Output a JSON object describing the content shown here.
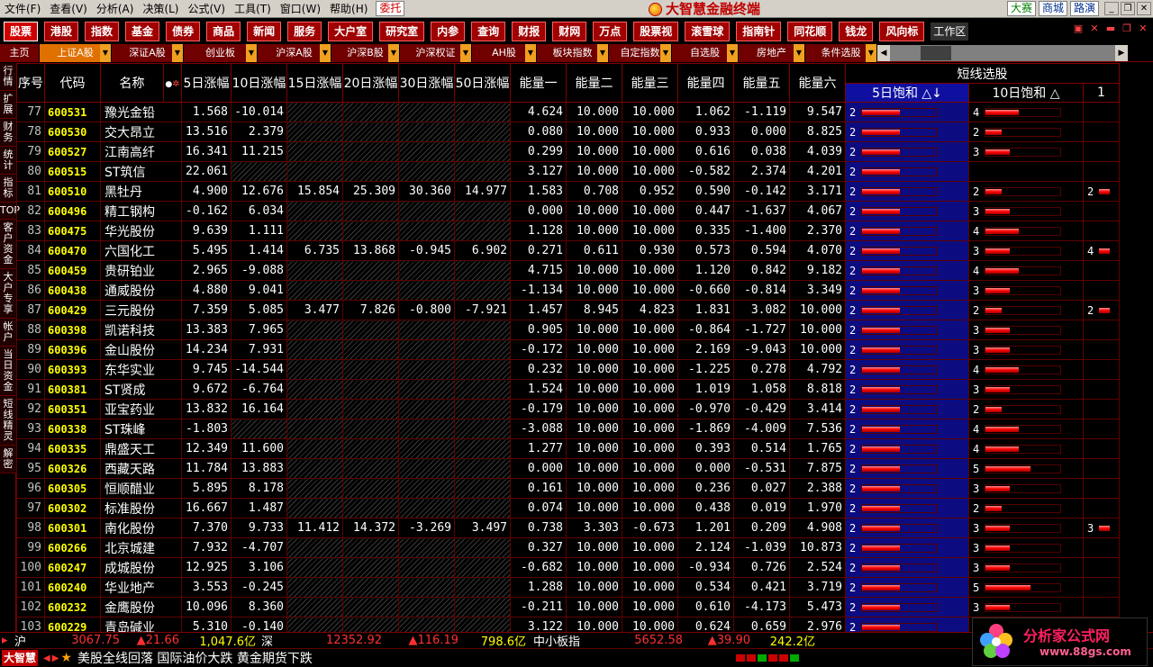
{
  "menubar": {
    "items": [
      "文件(F)",
      "查看(V)",
      "分析(A)",
      "决策(L)",
      "公式(V)",
      "工具(T)",
      "窗口(W)",
      "帮助(H)"
    ],
    "entrust": "委托",
    "title": "大智慧金融终端",
    "right_links": [
      "大赛",
      "商城",
      "路演"
    ]
  },
  "toolbar": {
    "buttons": [
      "股票",
      "港股",
      "指数",
      "基金",
      "债券",
      "商品",
      "新闻",
      "服务",
      "大户室",
      "研究室",
      "内参",
      "查询",
      "财报",
      "财网",
      "万点",
      "股票视",
      "滚雪球",
      "指南针",
      "同花顺",
      "钱龙",
      "风向标"
    ],
    "active": 0,
    "workspace": "工作区"
  },
  "tabs": {
    "items": [
      "主页",
      "上证A股",
      "深证A股",
      "创业板",
      "沪深A股",
      "沪深B股",
      "沪深权证",
      "AH股",
      "板块指数",
      "自定指数",
      "自选股",
      "房地产",
      "条件选股"
    ],
    "active": 1
  },
  "leftbar": [
    "行情",
    "扩展",
    "财务",
    "统计",
    "指标",
    "TOP",
    "客户资金",
    "大户专享",
    "帐户",
    "当日资金",
    "短线精灵",
    "解密"
  ],
  "grid": {
    "group_header": "短线选股",
    "headers": [
      "序号",
      "代码",
      "名称",
      "5日涨幅",
      "10日涨幅",
      "15日涨幅",
      "20日涨幅",
      "30日涨幅",
      "50日涨幅",
      "能量一",
      "能量二",
      "能量三",
      "能量四",
      "能量五",
      "能量六",
      "5日饱和 △↓",
      "10日饱和 △",
      "1"
    ],
    "rows": [
      {
        "seq": "77",
        "code": "600531",
        "name": "豫光金铅",
        "r5": "1.568",
        "r10": "-10.014",
        "r15": "",
        "r20": "",
        "r30": "",
        "r50": "",
        "e1": "4.624",
        "e2": "10.000",
        "e3": "10.000",
        "e4": "1.062",
        "e5": "-1.119",
        "e6": "9.547",
        "s5": "2",
        "s5f": 0.5,
        "s10": "4",
        "s10f": 0.45,
        "x": ""
      },
      {
        "seq": "78",
        "code": "600530",
        "name": "交大昂立",
        "r5": "13.516",
        "r10": "2.379",
        "r15": "",
        "r20": "",
        "r30": "",
        "r50": "",
        "e1": "0.080",
        "e2": "10.000",
        "e3": "10.000",
        "e4": "0.933",
        "e5": "0.000",
        "e6": "8.825",
        "s5": "2",
        "s5f": 0.5,
        "s10": "2",
        "s10f": 0.22,
        "x": ""
      },
      {
        "seq": "79",
        "code": "600527",
        "name": "江南高纤",
        "r5": "16.341",
        "r10": "11.215",
        "r15": "",
        "r20": "",
        "r30": "",
        "r50": "",
        "e1": "0.299",
        "e2": "10.000",
        "e3": "10.000",
        "e4": "0.616",
        "e5": "0.038",
        "e6": "4.039",
        "s5": "2",
        "s5f": 0.5,
        "s10": "3",
        "s10f": 0.32,
        "x": ""
      },
      {
        "seq": "80",
        "code": "600515",
        "name": "ST筑信",
        "r5": "22.061",
        "r10": "",
        "r15": "",
        "r20": "",
        "r30": "",
        "r50": "",
        "e1": "3.127",
        "e2": "10.000",
        "e3": "10.000",
        "e4": "-0.582",
        "e5": "2.374",
        "e6": "4.201",
        "s5": "2",
        "s5f": 0.5,
        "s10": "",
        "s10f": 0,
        "x": ""
      },
      {
        "seq": "81",
        "code": "600510",
        "name": "黑牡丹",
        "r5": "4.900",
        "r10": "12.676",
        "r15": "15.854",
        "r20": "25.309",
        "r30": "30.360",
        "r50": "14.977",
        "e1": "1.583",
        "e2": "0.708",
        "e3": "0.952",
        "e4": "0.590",
        "e5": "-0.142",
        "e6": "3.171",
        "s5": "2",
        "s5f": 0.5,
        "s10": "2",
        "s10f": 0.22,
        "x": "2"
      },
      {
        "seq": "82",
        "code": "600496",
        "name": "精工钢构",
        "r5": "-0.162",
        "r10": "6.034",
        "r15": "",
        "r20": "",
        "r30": "",
        "r50": "",
        "e1": "0.000",
        "e2": "10.000",
        "e3": "10.000",
        "e4": "0.447",
        "e5": "-1.637",
        "e6": "4.067",
        "s5": "2",
        "s5f": 0.5,
        "s10": "3",
        "s10f": 0.32,
        "x": ""
      },
      {
        "seq": "83",
        "code": "600475",
        "name": "华光股份",
        "r5": "9.639",
        "r10": "1.111",
        "r15": "",
        "r20": "",
        "r30": "",
        "r50": "",
        "e1": "1.128",
        "e2": "10.000",
        "e3": "10.000",
        "e4": "0.335",
        "e5": "-1.400",
        "e6": "2.370",
        "s5": "2",
        "s5f": 0.5,
        "s10": "4",
        "s10f": 0.45,
        "x": ""
      },
      {
        "seq": "84",
        "code": "600470",
        "name": "六国化工",
        "r5": "5.495",
        "r10": "1.414",
        "r15": "6.735",
        "r20": "13.868",
        "r30": "-0.945",
        "r50": "6.902",
        "e1": "0.271",
        "e2": "0.611",
        "e3": "0.930",
        "e4": "0.573",
        "e5": "0.594",
        "e6": "4.070",
        "s5": "2",
        "s5f": 0.5,
        "s10": "3",
        "s10f": 0.32,
        "x": "4"
      },
      {
        "seq": "85",
        "code": "600459",
        "name": "贵研铂业",
        "r5": "2.965",
        "r10": "-9.088",
        "r15": "",
        "r20": "",
        "r30": "",
        "r50": "",
        "e1": "4.715",
        "e2": "10.000",
        "e3": "10.000",
        "e4": "1.120",
        "e5": "0.842",
        "e6": "9.182",
        "s5": "2",
        "s5f": 0.5,
        "s10": "4",
        "s10f": 0.45,
        "x": ""
      },
      {
        "seq": "86",
        "code": "600438",
        "name": "通威股份",
        "r5": "4.880",
        "r10": "9.041",
        "r15": "",
        "r20": "",
        "r30": "",
        "r50": "",
        "e1": "-1.134",
        "e2": "10.000",
        "e3": "10.000",
        "e4": "-0.660",
        "e5": "-0.814",
        "e6": "3.349",
        "s5": "2",
        "s5f": 0.5,
        "s10": "3",
        "s10f": 0.32,
        "x": ""
      },
      {
        "seq": "87",
        "code": "600429",
        "name": "三元股份",
        "r5": "7.359",
        "r10": "5.085",
        "r15": "3.477",
        "r20": "7.826",
        "r30": "-0.800",
        "r50": "-7.921",
        "e1": "1.457",
        "e2": "8.945",
        "e3": "4.823",
        "e4": "1.831",
        "e5": "3.082",
        "e6": "10.000",
        "s5": "2",
        "s5f": 0.5,
        "s10": "2",
        "s10f": 0.22,
        "x": "2"
      },
      {
        "seq": "88",
        "code": "600398",
        "name": "凯诺科技",
        "r5": "13.383",
        "r10": "7.965",
        "r15": "",
        "r20": "",
        "r30": "",
        "r50": "",
        "e1": "0.905",
        "e2": "10.000",
        "e3": "10.000",
        "e4": "-0.864",
        "e5": "-1.727",
        "e6": "10.000",
        "s5": "2",
        "s5f": 0.5,
        "s10": "3",
        "s10f": 0.32,
        "x": ""
      },
      {
        "seq": "89",
        "code": "600396",
        "name": "金山股份",
        "r5": "14.234",
        "r10": "7.931",
        "r15": "",
        "r20": "",
        "r30": "",
        "r50": "",
        "e1": "-0.172",
        "e2": "10.000",
        "e3": "10.000",
        "e4": "2.169",
        "e5": "-9.043",
        "e6": "10.000",
        "s5": "2",
        "s5f": 0.5,
        "s10": "3",
        "s10f": 0.32,
        "x": ""
      },
      {
        "seq": "90",
        "code": "600393",
        "name": "东华实业",
        "r5": "9.745",
        "r10": "-14.544",
        "r15": "",
        "r20": "",
        "r30": "",
        "r50": "",
        "e1": "0.232",
        "e2": "10.000",
        "e3": "10.000",
        "e4": "-1.225",
        "e5": "0.278",
        "e6": "4.792",
        "s5": "2",
        "s5f": 0.5,
        "s10": "4",
        "s10f": 0.45,
        "x": ""
      },
      {
        "seq": "91",
        "code": "600381",
        "name": "ST贤成",
        "r5": "9.672",
        "r10": "-6.764",
        "r15": "",
        "r20": "",
        "r30": "",
        "r50": "",
        "e1": "1.524",
        "e2": "10.000",
        "e3": "10.000",
        "e4": "1.019",
        "e5": "1.058",
        "e6": "8.818",
        "s5": "2",
        "s5f": 0.5,
        "s10": "3",
        "s10f": 0.32,
        "x": ""
      },
      {
        "seq": "92",
        "code": "600351",
        "name": "亚宝药业",
        "r5": "13.832",
        "r10": "16.164",
        "r15": "",
        "r20": "",
        "r30": "",
        "r50": "",
        "e1": "-0.179",
        "e2": "10.000",
        "e3": "10.000",
        "e4": "-0.970",
        "e5": "-0.429",
        "e6": "3.414",
        "s5": "2",
        "s5f": 0.5,
        "s10": "2",
        "s10f": 0.22,
        "x": ""
      },
      {
        "seq": "93",
        "code": "600338",
        "name": "ST珠峰",
        "r5": "-1.803",
        "r10": "",
        "r15": "",
        "r20": "",
        "r30": "",
        "r50": "",
        "e1": "-3.088",
        "e2": "10.000",
        "e3": "10.000",
        "e4": "-1.869",
        "e5": "-4.009",
        "e6": "7.536",
        "s5": "2",
        "s5f": 0.5,
        "s10": "4",
        "s10f": 0.45,
        "x": ""
      },
      {
        "seq": "94",
        "code": "600335",
        "name": "鼎盛天工",
        "r5": "12.349",
        "r10": "11.600",
        "r15": "",
        "r20": "",
        "r30": "",
        "r50": "",
        "e1": "1.277",
        "e2": "10.000",
        "e3": "10.000",
        "e4": "0.393",
        "e5": "0.514",
        "e6": "1.765",
        "s5": "2",
        "s5f": 0.5,
        "s10": "4",
        "s10f": 0.45,
        "x": ""
      },
      {
        "seq": "95",
        "code": "600326",
        "name": "西藏天路",
        "r5": "11.784",
        "r10": "13.883",
        "r15": "",
        "r20": "",
        "r30": "",
        "r50": "",
        "e1": "0.000",
        "e2": "10.000",
        "e3": "10.000",
        "e4": "0.000",
        "e5": "-0.531",
        "e6": "7.875",
        "s5": "2",
        "s5f": 0.5,
        "s10": "5",
        "s10f": 0.6,
        "x": ""
      },
      {
        "seq": "96",
        "code": "600305",
        "name": "恒顺醋业",
        "r5": "5.895",
        "r10": "8.178",
        "r15": "",
        "r20": "",
        "r30": "",
        "r50": "",
        "e1": "0.161",
        "e2": "10.000",
        "e3": "10.000",
        "e4": "0.236",
        "e5": "0.027",
        "e6": "2.388",
        "s5": "2",
        "s5f": 0.5,
        "s10": "3",
        "s10f": 0.32,
        "x": ""
      },
      {
        "seq": "97",
        "code": "600302",
        "name": "标准股份",
        "r5": "16.667",
        "r10": "1.487",
        "r15": "",
        "r20": "",
        "r30": "",
        "r50": "",
        "e1": "0.074",
        "e2": "10.000",
        "e3": "10.000",
        "e4": "0.438",
        "e5": "0.019",
        "e6": "1.970",
        "s5": "2",
        "s5f": 0.5,
        "s10": "2",
        "s10f": 0.22,
        "x": ""
      },
      {
        "seq": "98",
        "code": "600301",
        "name": "南化股份",
        "r5": "7.370",
        "r10": "9.733",
        "r15": "11.412",
        "r20": "14.372",
        "r30": "-3.269",
        "r50": "3.497",
        "e1": "0.738",
        "e2": "3.303",
        "e3": "-0.673",
        "e4": "1.201",
        "e5": "0.209",
        "e6": "4.908",
        "s5": "2",
        "s5f": 0.5,
        "s10": "3",
        "s10f": 0.32,
        "x": "3"
      },
      {
        "seq": "99",
        "code": "600266",
        "name": "北京城建",
        "r5": "7.932",
        "r10": "-4.707",
        "r15": "",
        "r20": "",
        "r30": "",
        "r50": "",
        "e1": "0.327",
        "e2": "10.000",
        "e3": "10.000",
        "e4": "2.124",
        "e5": "-1.039",
        "e6": "10.873",
        "s5": "2",
        "s5f": 0.5,
        "s10": "3",
        "s10f": 0.32,
        "x": ""
      },
      {
        "seq": "100",
        "code": "600247",
        "name": "成城股份",
        "r5": "12.925",
        "r10": "3.106",
        "r15": "",
        "r20": "",
        "r30": "",
        "r50": "",
        "e1": "-0.682",
        "e2": "10.000",
        "e3": "10.000",
        "e4": "-0.934",
        "e5": "0.726",
        "e6": "2.524",
        "s5": "2",
        "s5f": 0.5,
        "s10": "3",
        "s10f": 0.32,
        "x": ""
      },
      {
        "seq": "101",
        "code": "600240",
        "name": "华业地产",
        "r5": "3.553",
        "r10": "-0.245",
        "r15": "",
        "r20": "",
        "r30": "",
        "r50": "",
        "e1": "1.288",
        "e2": "10.000",
        "e3": "10.000",
        "e4": "0.534",
        "e5": "0.421",
        "e6": "3.719",
        "s5": "2",
        "s5f": 0.5,
        "s10": "5",
        "s10f": 0.6,
        "x": ""
      },
      {
        "seq": "102",
        "code": "600232",
        "name": "金鹰股份",
        "r5": "10.096",
        "r10": "8.360",
        "r15": "",
        "r20": "",
        "r30": "",
        "r50": "",
        "e1": "-0.211",
        "e2": "10.000",
        "e3": "10.000",
        "e4": "0.610",
        "e5": "-4.173",
        "e6": "5.473",
        "s5": "2",
        "s5f": 0.5,
        "s10": "3",
        "s10f": 0.32,
        "x": ""
      },
      {
        "seq": "103",
        "code": "600229",
        "name": "青岛碱业",
        "r5": "5.310",
        "r10": "-0.140",
        "r15": "",
        "r20": "",
        "r30": "",
        "r50": "",
        "e1": "3.122",
        "e2": "10.000",
        "e3": "10.000",
        "e4": "0.624",
        "e5": "0.659",
        "e6": "2.976",
        "s5": "2",
        "s5f": 0.5,
        "s10": "3",
        "s10f": 0.32,
        "x": ""
      }
    ]
  },
  "status": {
    "sh_label": "沪",
    "sh_index": "3067.75",
    "sh_change": "▲21.66",
    "sh_amount": "1,047.6亿",
    "sz_label": "深",
    "sz_index": "12352.92",
    "sz_change": "▲116.19",
    "sz_amount": "798.6亿",
    "mid_label": "中小板指",
    "mid_index": "5652.58",
    "mid_change": "▲39.90",
    "mid_amount": "242.2亿",
    "brand": "大智慧",
    "news": "美股全线回落 国际油价大跌 黄金期货下跌"
  },
  "watermark": {
    "title": "分析家公式网",
    "url": "www.88gs.com"
  },
  "colors": {
    "background": "#000000",
    "grid_line": "#800000",
    "code": "#ffff00",
    "bar": "#ff0000",
    "selected_col": "#0c0c80",
    "up": "#ff3030"
  }
}
